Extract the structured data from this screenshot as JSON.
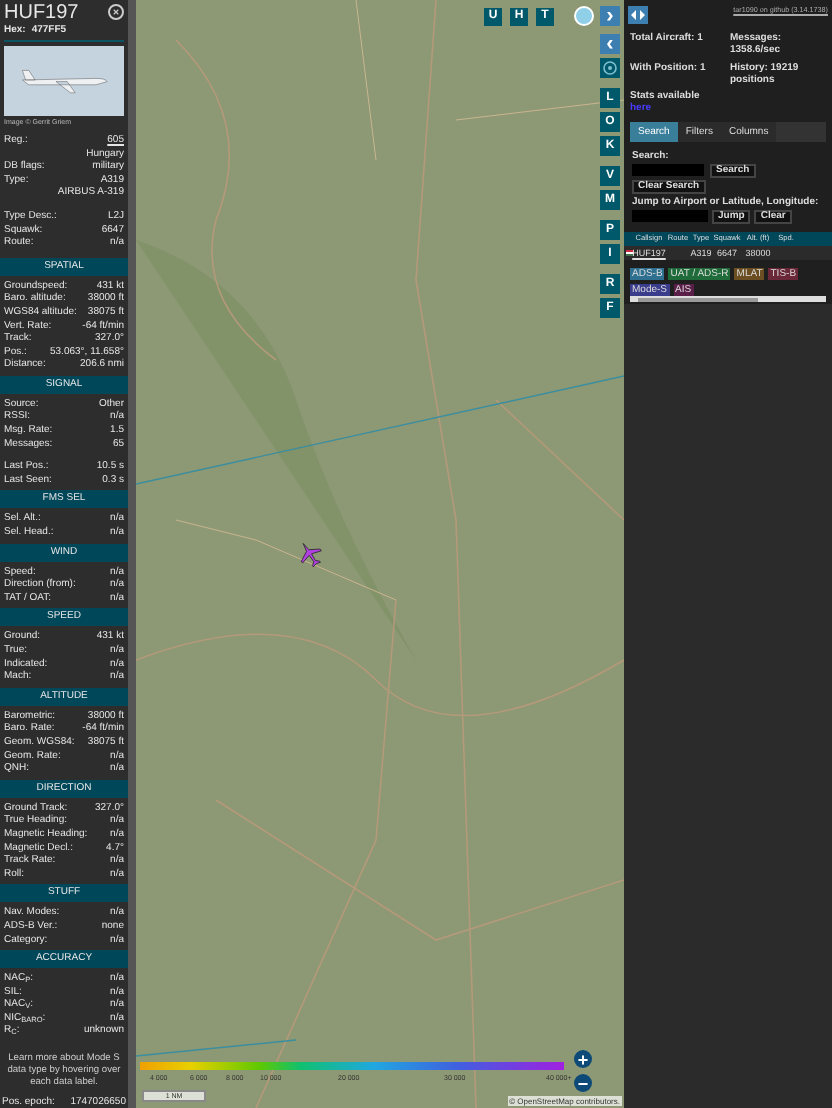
{
  "aircraft": {
    "callsign": "HUF197",
    "hex_label": "Hex:",
    "hex": "477FF5",
    "photo_credit": "Image © Gerrit Griem"
  },
  "details": [
    [
      {
        "label": "Reg.:",
        "value": "605",
        "link": true
      },
      {
        "value": "Hungary"
      },
      {
        "label": "DB flags:",
        "value": "military"
      },
      {
        "label": "Type:",
        "value": "A319"
      },
      {
        "value": "AIRBUS A-319"
      }
    ],
    [
      {
        "label": "Type Desc.:",
        "value": "L2J"
      },
      {
        "label": "Squawk:",
        "value": "6647"
      },
      {
        "label": "Route:",
        "value": "n/a"
      }
    ]
  ],
  "sections": [
    {
      "title": "SPATIAL",
      "groups": [
        [
          {
            "label": "Groundspeed:",
            "value": "431 kt"
          },
          {
            "label": "Baro. altitude:",
            "value": "38000 ft"
          },
          {
            "label": "WGS84 altitude:",
            "value": "38075 ft"
          },
          {
            "label": "Vert. Rate:",
            "value": "-64 ft/min"
          },
          {
            "label": "Track:",
            "value": "327.0°"
          },
          {
            "label": "Pos.:",
            "value": "53.063°, 11.658°"
          },
          {
            "label": "Distance:",
            "value": "206.6 nmi"
          }
        ]
      ]
    },
    {
      "title": "SIGNAL",
      "groups": [
        [
          {
            "label": "Source:",
            "value": "Other"
          },
          {
            "label": "RSSI:",
            "value": "n/a"
          },
          {
            "label": "Msg. Rate:",
            "value": "1.5"
          },
          {
            "label": "Messages:",
            "value": "65"
          }
        ],
        [
          {
            "label": "Last Pos.:",
            "value": "10.5 s"
          },
          {
            "label": "Last Seen:",
            "value": "0.3 s"
          }
        ]
      ]
    },
    {
      "title": "FMS SEL",
      "groups": [
        [
          {
            "label": "Sel. Alt.:",
            "value": "n/a"
          },
          {
            "label": "Sel. Head.:",
            "value": "n/a"
          }
        ]
      ]
    },
    {
      "title": "WIND",
      "groups": [
        [
          {
            "label": "Speed:",
            "value": "n/a"
          },
          {
            "label": "Direction (from):",
            "value": "n/a"
          },
          {
            "label": "TAT / OAT:",
            "value": "n/a"
          }
        ]
      ]
    },
    {
      "title": "SPEED",
      "groups": [
        [
          {
            "label": "Ground:",
            "value": "431 kt"
          },
          {
            "label": "True:",
            "value": "n/a"
          },
          {
            "label": "Indicated:",
            "value": "n/a"
          },
          {
            "label": "Mach:",
            "value": "n/a"
          }
        ]
      ]
    },
    {
      "title": "ALTITUDE",
      "groups": [
        [
          {
            "label": "Barometric:",
            "value": "38000 ft"
          },
          {
            "label": "Baro. Rate:",
            "value": "-64 ft/min"
          },
          {
            "label": "Geom. WGS84:",
            "value": "38075 ft"
          },
          {
            "label": "Geom. Rate:",
            "value": "n/a"
          },
          {
            "label": "QNH:",
            "value": "n/a"
          }
        ]
      ]
    },
    {
      "title": "DIRECTION",
      "groups": [
        [
          {
            "label": "Ground Track:",
            "value": "327.0°"
          },
          {
            "label": "True Heading:",
            "value": "n/a"
          },
          {
            "label": "Magnetic Heading:",
            "value": "n/a"
          },
          {
            "label": "Magnetic Decl.:",
            "value": "4.7°"
          },
          {
            "label": "Track Rate:",
            "value": "n/a"
          },
          {
            "label": "Roll:",
            "value": "n/a"
          }
        ]
      ]
    },
    {
      "title": "STUFF",
      "groups": [
        [
          {
            "label": "Nav. Modes:",
            "value": "n/a"
          },
          {
            "label": "ADS-B Ver.:",
            "value": "none"
          },
          {
            "label": "Category:",
            "value": "n/a"
          }
        ]
      ]
    },
    {
      "title": "ACCURACY",
      "groups": [
        [
          {
            "label": "NAC$_{P}$:",
            "value": "n/a"
          },
          {
            "label": "SIL:",
            "value": "n/a"
          },
          {
            "label": "NAC$_{V}$:",
            "value": "n/a"
          },
          {
            "label": "NIC$_{BARO}$:",
            "value": "n/a"
          },
          {
            "label": "R$_{C}$:",
            "value": "unknown"
          }
        ]
      ]
    }
  ],
  "sidebar_note": "Learn more about Mode S data type by hovering over each data label.",
  "pos_epoch": {
    "label": "Pos. epoch:",
    "value": "1747026650"
  },
  "map_buttons": [
    "U",
    "H",
    "T"
  ],
  "side_buttons": [
    {
      "kind": "icon",
      "glyph": "›"
    },
    {
      "kind": "icon",
      "glyph": "‹"
    },
    {
      "kind": "gear"
    },
    {
      "kind": "letter",
      "glyph": "L"
    },
    {
      "kind": "letter",
      "glyph": "O"
    },
    {
      "kind": "letter",
      "glyph": "K"
    },
    {
      "kind": "letter",
      "glyph": "V"
    },
    {
      "kind": "letter",
      "glyph": "M"
    },
    {
      "kind": "letter",
      "glyph": "P"
    },
    {
      "kind": "letter",
      "glyph": "I"
    },
    {
      "kind": "letter",
      "glyph": "R"
    },
    {
      "kind": "letter",
      "glyph": "F"
    }
  ],
  "altitude_legend": [
    "4 000",
    "6 000",
    "8 000",
    "10 000",
    "20 000",
    "30 000",
    "40 000+"
  ],
  "scale": "1 NM",
  "attribution": "© OpenStreetMap contributors.",
  "zoom": [
    "+",
    "−"
  ],
  "panel": {
    "version_link": "tar1090 on github (3.14.1738)",
    "stats": [
      {
        "label": "Total Aircraft: 1"
      },
      {
        "label": "Messages: 1358.6/sec"
      },
      {
        "label": "With Position: 1"
      },
      {
        "label": "History: 19219 positions"
      }
    ],
    "stats_note": "Stats available",
    "stats_link": "here",
    "tabs": [
      {
        "label": "Search",
        "selected": true
      },
      {
        "label": "Filters",
        "selected": false
      },
      {
        "label": "Columns",
        "selected": false
      }
    ],
    "search_label": "Search:",
    "search_button": "Search",
    "clear_search": "Clear Search",
    "jump_label": "Jump to Airport or Latitude, Longitude:",
    "jump_button": "Jump",
    "clear_button": "Clear"
  },
  "table": {
    "columns": [
      "Callsign",
      "Route",
      "Type",
      "Squawk",
      "Alt. (ft)",
      "Spd."
    ],
    "rows": [
      {
        "callsign": "HUF197",
        "route": "",
        "type": "A319",
        "squawk": "6647",
        "altitude": "38000"
      }
    ]
  },
  "sources": [
    {
      "label": "ADS-B",
      "color": "#2f6f8f"
    },
    {
      "label": "UAT / ADS-R",
      "color": "#1f6b3a"
    },
    {
      "label": "MLAT",
      "color": "#6b4f22"
    },
    {
      "label": "TIS-B",
      "color": "#6a2838"
    },
    {
      "label": "Mode-S",
      "color": "#3a3d8c"
    },
    {
      "label": "AIS",
      "color": "#5a1f48"
    }
  ]
}
